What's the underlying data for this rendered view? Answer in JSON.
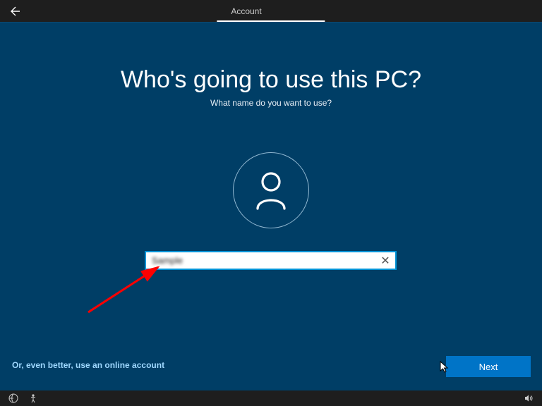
{
  "header": {
    "tab_label": "Account"
  },
  "main": {
    "heading": "Who's going to use this PC?",
    "subheading": "What name do you want to use?",
    "username_value": "Sample",
    "online_link": "Or, even better, use an online account",
    "next_label": "Next"
  }
}
